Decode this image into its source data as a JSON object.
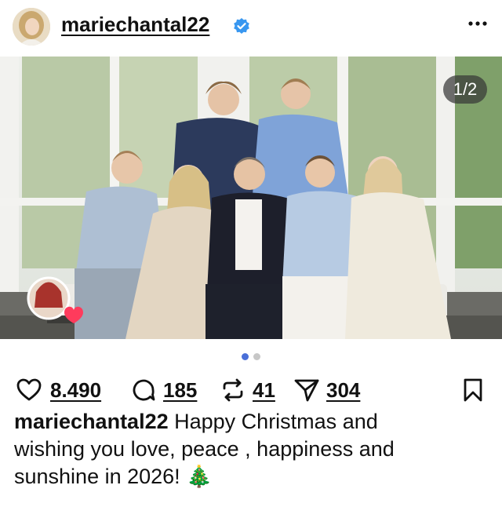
{
  "post": {
    "username": "mariechantal22",
    "verified": true,
    "image_counter": "1/2",
    "carousel": {
      "current": 1,
      "total": 2
    }
  },
  "actions": {
    "likes": "8.490",
    "comments": "185",
    "reposts": "41",
    "shares": "304"
  },
  "caption": {
    "username": "mariechantal22",
    "text": "Happy Christmas and wishing you love, peace , happiness and sunshine in 2026!",
    "emoji": "🎄"
  },
  "colors": {
    "verified_badge": "#3897f0",
    "active_dot": "#4a6fd8",
    "inactive_dot": "#c7c7c7",
    "story_heart": "#ff3b5c"
  },
  "icons": {
    "more": "more-horizontal-icon",
    "like": "heart-icon",
    "comment": "comment-icon",
    "repost": "repost-icon",
    "share": "send-icon",
    "save": "bookmark-icon"
  }
}
